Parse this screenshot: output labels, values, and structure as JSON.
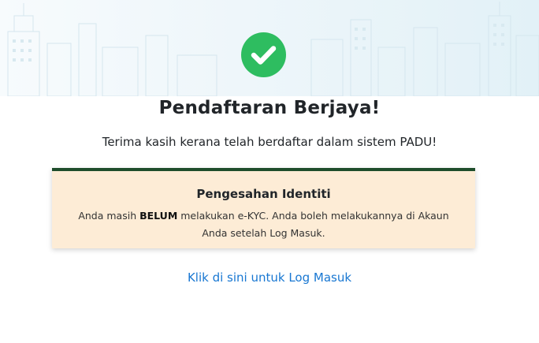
{
  "header": {
    "status_icon": "check-circle-icon",
    "title": "Pendaftaran Berjaya!",
    "subtitle": "Terima kasih kerana telah berdaftar dalam sistem PADU!"
  },
  "notice": {
    "title": "Pengesahan Identiti",
    "body_prefix": "Anda masih ",
    "body_emphasis": "BELUM",
    "body_suffix": " melakukan e-KYC. Anda boleh melakukannya di Akaun Anda setelah Log Masuk."
  },
  "login_link": {
    "label": "Klik di sini untuk Log Masuk"
  },
  "colors": {
    "success_green": "#2ebd60",
    "notice_background": "#fdecd6",
    "notice_border": "#1e4d2b",
    "link_blue": "#1877d2"
  }
}
